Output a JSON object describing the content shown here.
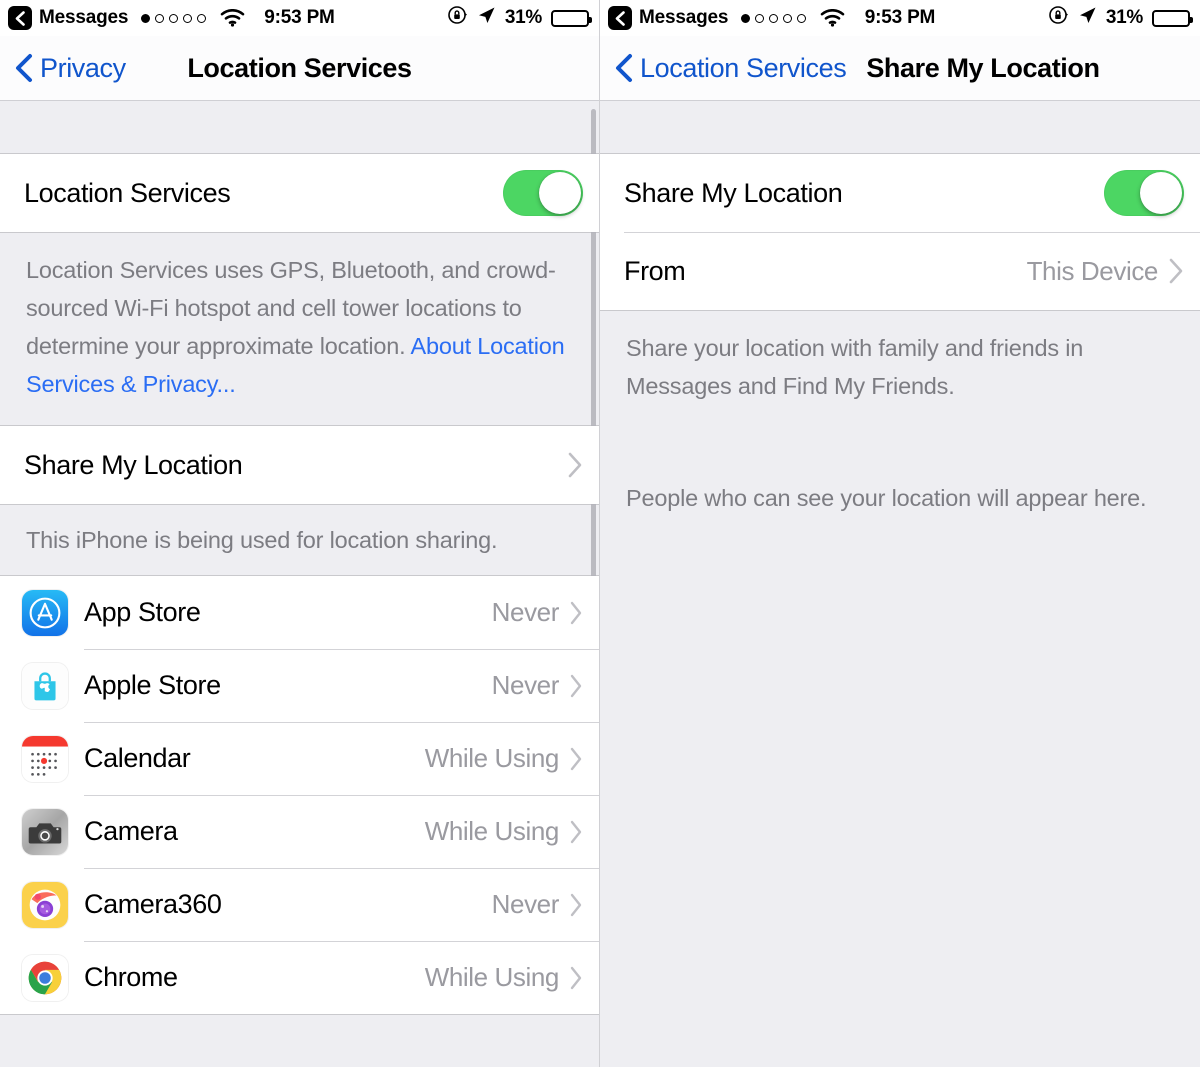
{
  "status_bar": {
    "back_app": "Messages",
    "signal_dots_total": 5,
    "signal_dots_filled": 1,
    "wifi_icon": "wifi-icon",
    "time": "9:53 PM",
    "rotation_lock_icon": "rotation-lock-icon",
    "location_arrow_icon": "location-arrow-icon",
    "battery_percent": "31%",
    "battery_level": 31
  },
  "left_panel": {
    "nav": {
      "back_label": "Privacy",
      "title": "Location Services",
      "back_chevron_icon": "chevron-left-icon"
    },
    "location_services_row": {
      "label": "Location Services",
      "toggle_on": true
    },
    "location_services_footer": {
      "text": "Location Services uses GPS, Bluetooth, and crowd-sourced Wi-Fi hotspot and cell tower locations to determine your approximate location. ",
      "link_text": "About Location Services & Privacy..."
    },
    "share_my_location_row": {
      "label": "Share My Location",
      "chevron_icon": "chevron-right-icon"
    },
    "share_my_location_footer": "This iPhone is being used for location sharing.",
    "apps": [
      {
        "name": "App Store",
        "value": "Never",
        "icon": "app-store-icon"
      },
      {
        "name": "Apple Store",
        "value": "Never",
        "icon": "apple-store-icon"
      },
      {
        "name": "Calendar",
        "value": "While Using",
        "icon": "calendar-icon"
      },
      {
        "name": "Camera",
        "value": "While Using",
        "icon": "camera-icon"
      },
      {
        "name": "Camera360",
        "value": "Never",
        "icon": "camera360-icon"
      },
      {
        "name": "Chrome",
        "value": "While Using",
        "icon": "chrome-icon"
      }
    ]
  },
  "right_panel": {
    "nav": {
      "back_label": "Location Services",
      "title": "Share My Location",
      "back_chevron_icon": "chevron-left-icon"
    },
    "share_row": {
      "label": "Share My Location",
      "toggle_on": true
    },
    "from_row": {
      "label": "From",
      "value": "This Device",
      "chevron_icon": "chevron-right-icon"
    },
    "footer_1": "Share your location with family and friends in Messages and Find My Friends.",
    "footer_2": "People who can see your location will appear here."
  },
  "colors": {
    "toggle_on": "#4CD663",
    "link_blue": "#2A6DF4",
    "nav_blue": "#1055CC",
    "group_bg": "#FFFFFF",
    "page_bg": "#EEEEF2",
    "secondary_text": "#7C7C82",
    "value_text": "#9A9AA0"
  }
}
